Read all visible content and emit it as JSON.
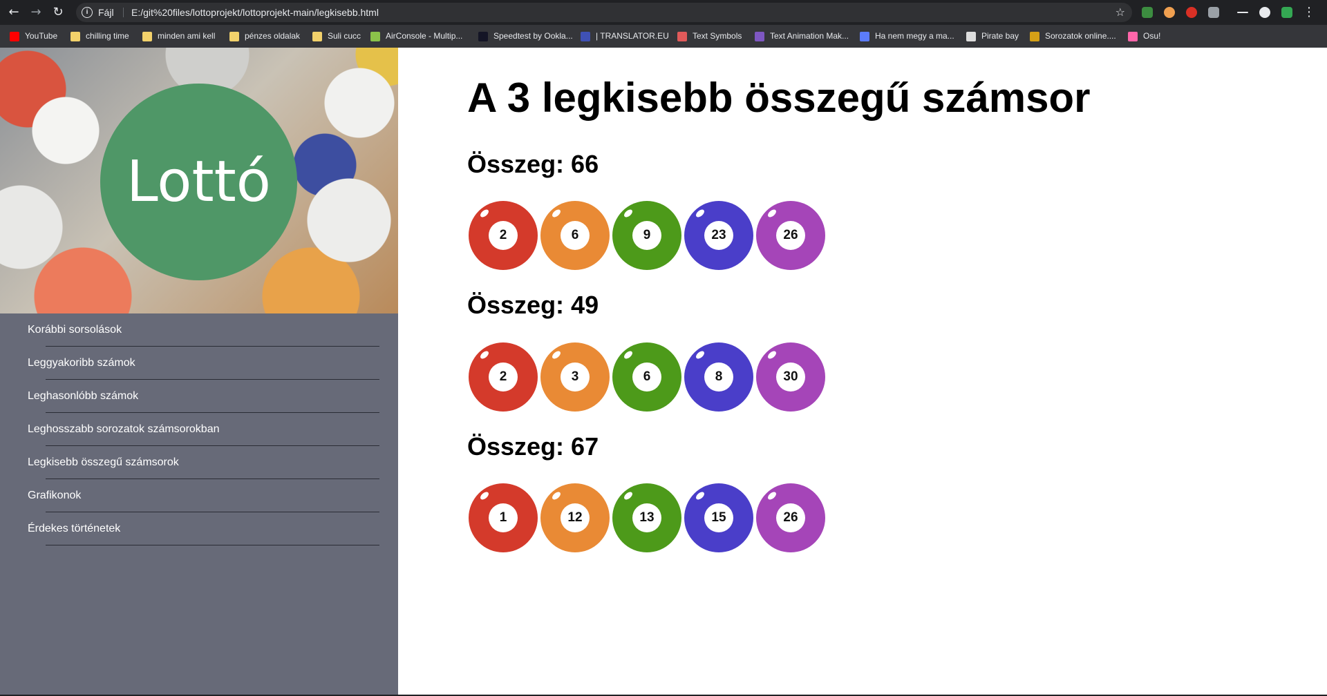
{
  "browser": {
    "url_scheme": "Fájl",
    "url": "E:/git%20files/lottoprojekt/lottoprojekt-main/legkisebb.html",
    "bookmarks": [
      {
        "label": "YouTube",
        "color": "#ff0000"
      },
      {
        "label": "chilling time",
        "color": "#f2d16b"
      },
      {
        "label": "minden ami kell",
        "color": "#f2d16b"
      },
      {
        "label": "pénzes oldalak",
        "color": "#f2d16b"
      },
      {
        "label": "Suli cucc",
        "color": "#f2d16b"
      },
      {
        "label": "AirConsole - Multip...",
        "color": "#8bc34a"
      },
      {
        "label": "Speedtest by Ookla...",
        "color": "#141526"
      },
      {
        "label": "| TRANSLATOR.EU",
        "color": "#3f51b5"
      },
      {
        "label": "Text Symbols",
        "color": "#e05a5a"
      },
      {
        "label": "Text Animation Mak...",
        "color": "#7e57c2"
      },
      {
        "label": "Ha nem megy a ma...",
        "color": "#5c7cfa"
      },
      {
        "label": "Pirate bay",
        "color": "#dddddd"
      },
      {
        "label": "Sorozatok online....",
        "color": "#d4a017"
      },
      {
        "label": "Osu!",
        "color": "#ff66aa"
      }
    ]
  },
  "sidebar": {
    "logo_text": "Lottó",
    "menu": [
      {
        "label": "Korábbi sorsolások"
      },
      {
        "label": "Leggyakoribb számok"
      },
      {
        "label": "Leghasonlóbb számok"
      },
      {
        "label": "Leghosszabb sorozatok számsorokban"
      },
      {
        "label": "Legkisebb összegű számsorok"
      },
      {
        "label": "Grafikonok"
      },
      {
        "label": "Érdekes történetek"
      }
    ]
  },
  "main": {
    "title": "A 3 legkisebb összegű számsor",
    "ball_colors": [
      "#d43a2b",
      "#e98a35",
      "#4d9a1a",
      "#4a3ec9",
      "#a545b8"
    ],
    "groups": [
      {
        "sum_label": "Összeg: 66",
        "numbers": [
          "2",
          "6",
          "9",
          "23",
          "26"
        ]
      },
      {
        "sum_label": "Összeg: 49",
        "numbers": [
          "2",
          "3",
          "6",
          "8",
          "30"
        ]
      },
      {
        "sum_label": "Összeg: 67",
        "numbers": [
          "1",
          "12",
          "13",
          "15",
          "26"
        ]
      }
    ]
  }
}
